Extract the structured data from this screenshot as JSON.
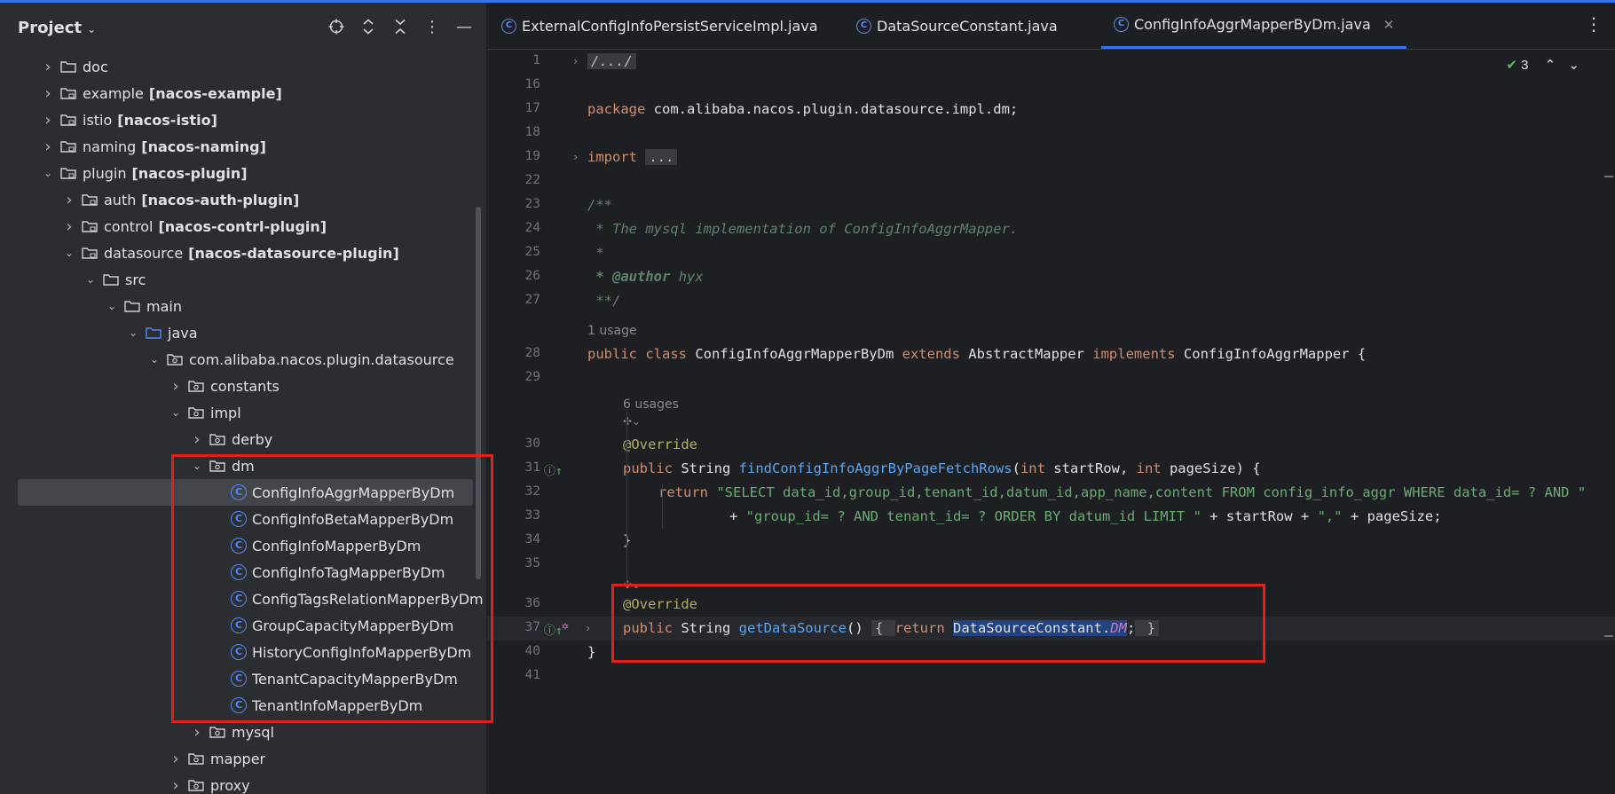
{
  "project_panel": {
    "title": "Project",
    "tree": [
      {
        "label": "doc",
        "module": "",
        "kind": "folder",
        "arrow": "right",
        "depth": 0
      },
      {
        "label": "example",
        "module": "[nacos-example]",
        "kind": "module",
        "arrow": "right",
        "depth": 0
      },
      {
        "label": "istio",
        "module": "[nacos-istio]",
        "kind": "module",
        "arrow": "right",
        "depth": 0
      },
      {
        "label": "naming",
        "module": "[nacos-naming]",
        "kind": "module",
        "arrow": "right",
        "depth": 0
      },
      {
        "label": "plugin",
        "module": "[nacos-plugin]",
        "kind": "module",
        "arrow": "down",
        "depth": 0
      },
      {
        "label": "auth",
        "module": "[nacos-auth-plugin]",
        "kind": "module",
        "arrow": "right",
        "depth": 1
      },
      {
        "label": "control",
        "module": "[nacos-contrl-plugin]",
        "kind": "module",
        "arrow": "right",
        "depth": 1
      },
      {
        "label": "datasource",
        "module": "[nacos-datasource-plugin]",
        "kind": "module",
        "arrow": "down",
        "depth": 1
      },
      {
        "label": "src",
        "module": "",
        "kind": "folder",
        "arrow": "down",
        "depth": 2
      },
      {
        "label": "main",
        "module": "",
        "kind": "folder",
        "arrow": "down",
        "depth": 3
      },
      {
        "label": "java",
        "module": "",
        "kind": "source",
        "arrow": "down",
        "depth": 4
      },
      {
        "label": "com.alibaba.nacos.plugin.datasource",
        "module": "",
        "kind": "package",
        "arrow": "down",
        "depth": 5
      },
      {
        "label": "constants",
        "module": "",
        "kind": "package",
        "arrow": "right",
        "depth": 6
      },
      {
        "label": "impl",
        "module": "",
        "kind": "package",
        "arrow": "down",
        "depth": 6
      },
      {
        "label": "derby",
        "module": "",
        "kind": "package",
        "arrow": "right",
        "depth": 7
      },
      {
        "label": "dm",
        "module": "",
        "kind": "package",
        "arrow": "down",
        "depth": 7
      },
      {
        "label": "ConfigInfoAggrMapperByDm",
        "module": "",
        "kind": "class",
        "arrow": "",
        "depth": 8,
        "selected": true
      },
      {
        "label": "ConfigInfoBetaMapperByDm",
        "module": "",
        "kind": "class",
        "arrow": "",
        "depth": 8
      },
      {
        "label": "ConfigInfoMapperByDm",
        "module": "",
        "kind": "class",
        "arrow": "",
        "depth": 8
      },
      {
        "label": "ConfigInfoTagMapperByDm",
        "module": "",
        "kind": "class",
        "arrow": "",
        "depth": 8
      },
      {
        "label": "ConfigTagsRelationMapperByDm",
        "module": "",
        "kind": "class",
        "arrow": "",
        "depth": 8
      },
      {
        "label": "GroupCapacityMapperByDm",
        "module": "",
        "kind": "class",
        "arrow": "",
        "depth": 8
      },
      {
        "label": "HistoryConfigInfoMapperByDm",
        "module": "",
        "kind": "class",
        "arrow": "",
        "depth": 8
      },
      {
        "label": "TenantCapacityMapperByDm",
        "module": "",
        "kind": "class",
        "arrow": "",
        "depth": 8
      },
      {
        "label": "TenantInfoMapperByDm",
        "module": "",
        "kind": "class",
        "arrow": "",
        "depth": 8
      },
      {
        "label": "mysql",
        "module": "",
        "kind": "package",
        "arrow": "right",
        "depth": 7
      },
      {
        "label": "mapper",
        "module": "",
        "kind": "package",
        "arrow": "right",
        "depth": 6
      },
      {
        "label": "proxy",
        "module": "",
        "kind": "package",
        "arrow": "right",
        "depth": 6
      }
    ]
  },
  "tabs": [
    {
      "label": "ExternalConfigInfoPersistServiceImpl.java",
      "active": false
    },
    {
      "label": "DataSourceConstant.java",
      "active": false
    },
    {
      "label": "ConfigInfoAggrMapperByDm.java",
      "active": true
    }
  ],
  "editor": {
    "inspection_count": "3",
    "usage_hint_class": "1 usage",
    "usage_hint_method": "6 usages",
    "lines": {
      "l1_num": "1",
      "l1": "/.../",
      "l16_num": "16",
      "l17_num": "17",
      "l17_kw": "package",
      "l17_rest": " com.alibaba.nacos.plugin.datasource.impl.dm;",
      "l18_num": "18",
      "l19_num": "19",
      "l19_kw": "import",
      "l19_rest": "...",
      "l22_num": "22",
      "l23_num": "23",
      "l23": "/**",
      "l24_num": "24",
      "l24": " * The mysql implementation of ConfigInfoAggrMapper.",
      "l25_num": "25",
      "l25": " *",
      "l26_num": "26",
      "l26_tag": " * @author",
      "l26_rest": " hyx",
      "l27_num": "27",
      "l27": " **/",
      "l28_num": "28",
      "l28_a": "public class",
      "l28_b": " ConfigInfoAggrMapperByDm ",
      "l28_c": "extends",
      "l28_d": " AbstractMapper ",
      "l28_e": "implements",
      "l28_f": " ConfigInfoAggrMapper {",
      "l29_num": "29",
      "l30_num": "30",
      "l30": "@Override",
      "l31_num": "31",
      "l31_a": "public",
      "l31_b": " String ",
      "l31_c": "findConfigInfoAggrByPageFetchRows",
      "l31_d": "(",
      "l31_e": "int",
      "l31_f": " startRow, ",
      "l31_g": "int",
      "l31_h": " pageSize) {",
      "l32_num": "32",
      "l32_a": "return ",
      "l32_b": "\"SELECT data_id,group_id,tenant_id,datum_id,app_name,content FROM config_info_aggr WHERE data_id= ? AND \"",
      "l33_num": "33",
      "l33_a": "+ ",
      "l33_b": "\"group_id= ? AND tenant_id= ? ORDER BY datum_id LIMIT \"",
      "l33_c": " + startRow + ",
      "l33_d": "\",\"",
      "l33_e": " + pageSize;",
      "l34_num": "34",
      "l34": "}",
      "l35_num": "35",
      "l36_num": "36",
      "l36": "@Override",
      "l37_num": "37",
      "l37_a": "public",
      "l37_b": " String ",
      "l37_c": "getDataSource",
      "l37_d": "() ",
      "l37_e": "{ ",
      "l37_f": "return ",
      "l37_g": "DataSourceConstant.",
      "l37_h": "DM",
      "l37_i": ";",
      "l37_j": " }",
      "l40_num": "40",
      "l40": "}",
      "l41_num": "41"
    }
  }
}
